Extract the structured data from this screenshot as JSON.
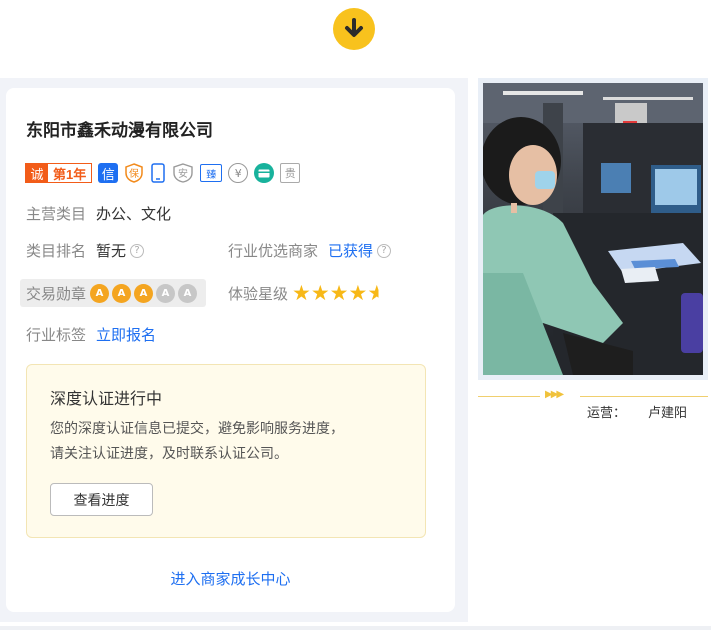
{
  "company": {
    "name": "东阳市鑫禾动漫有限公司"
  },
  "badges": {
    "cheng": "诚",
    "year": "第1年",
    "xin": "信",
    "bao": "保",
    "an": "安",
    "zhen": "臻",
    "yen": "¥",
    "gui": "贵"
  },
  "main_category": {
    "label": "主营类目",
    "value": "办公、文化"
  },
  "category_rank": {
    "label": "类目排名",
    "value": "暂无"
  },
  "industry_preferred": {
    "label": "行业优选商家",
    "value": "已获得"
  },
  "trade_medal": {
    "label": "交易勋章",
    "earned": 3,
    "total": 5,
    "medal_glyph": "A"
  },
  "experience_stars": {
    "label": "体验星级",
    "rating": 4.5,
    "max": 5
  },
  "industry_tag": {
    "label": "行业标签",
    "link": "立即报名"
  },
  "notice": {
    "title": "深度认证进行中",
    "line1": "您的深度认证信息已提交，避免影响服务进度，",
    "line2": "请关注认证进度，及时联系认证公司。",
    "button": "查看进度"
  },
  "enter_link": "进入商家成长中心",
  "operator": {
    "label": "运营：",
    "name": "卢建阳"
  },
  "colors": {
    "accent": "#1e6ff1",
    "brand_orange": "#f25c19",
    "yellow": "#f8c21d",
    "star": "#f7b817"
  },
  "icons": [
    "down-arrow-icon",
    "phone-icon",
    "shield-bao-icon",
    "shield-an-icon",
    "help-icon",
    "medal-icon",
    "star-icon",
    "card-icon"
  ]
}
